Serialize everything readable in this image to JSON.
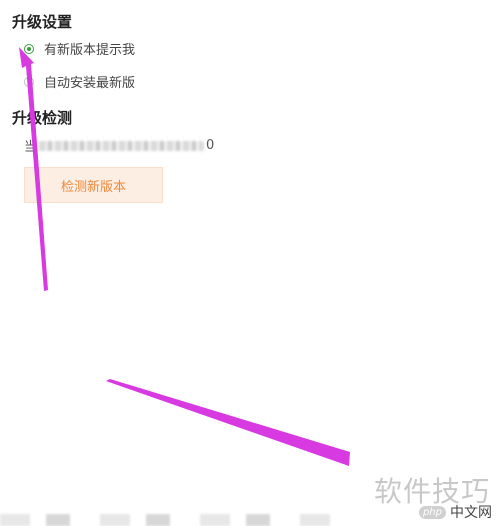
{
  "upgrade_settings": {
    "title": "升级设置",
    "options": [
      {
        "label": "有新版本提示我",
        "selected": true
      },
      {
        "label": "自动安装最新版",
        "selected": false
      }
    ]
  },
  "upgrade_check": {
    "title": "升级检测",
    "current_version_prefix": "当",
    "current_version_suffix": "0",
    "check_button_label": "检测新版本"
  },
  "watermark": {
    "text": "软件技巧",
    "php_badge": "php",
    "site": "中文网"
  },
  "colors": {
    "accent_green": "#3a9a3a",
    "button_bg": "#fdeee3",
    "button_text": "#f08a3c",
    "arrow": "#d63ae0"
  }
}
